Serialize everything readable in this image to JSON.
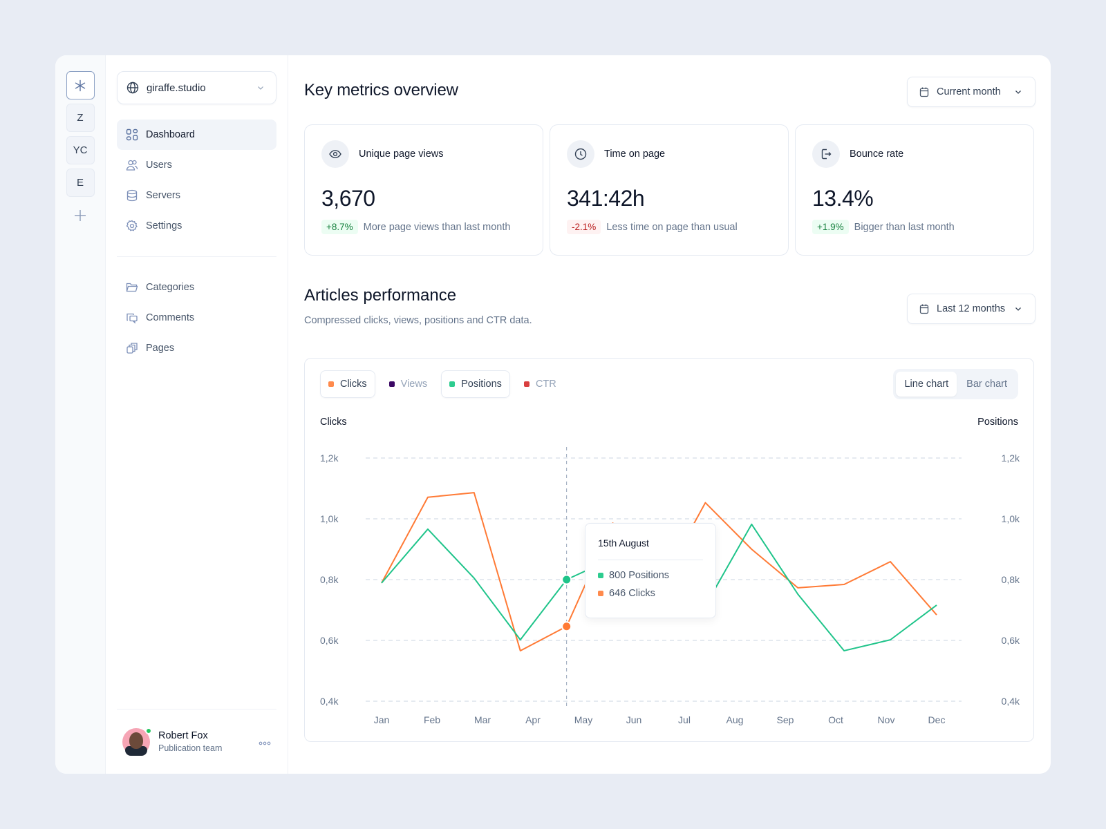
{
  "rail": {
    "items": [
      {
        "label": "",
        "icon": "asterisk-icon",
        "active": true
      },
      {
        "label": "Z"
      },
      {
        "label": "YC"
      },
      {
        "label": "E"
      }
    ],
    "add_icon": "plus-icon"
  },
  "sidebar": {
    "workspace": {
      "label": "giraffe.studio",
      "icon": "globe-icon"
    },
    "primary": [
      {
        "label": "Dashboard",
        "icon": "grid-icon",
        "active": true
      },
      {
        "label": "Users",
        "icon": "users-icon"
      },
      {
        "label": "Servers",
        "icon": "database-icon"
      },
      {
        "label": "Settings",
        "icon": "gear-icon"
      }
    ],
    "secondary": [
      {
        "label": "Categories",
        "icon": "folder-icon"
      },
      {
        "label": "Comments",
        "icon": "comments-icon"
      },
      {
        "label": "Pages",
        "icon": "pages-icon"
      }
    ],
    "user": {
      "name": "Robert Fox",
      "role": "Publication team",
      "status": "online"
    }
  },
  "header": {
    "title": "Key metrics overview",
    "period_select": "Current month"
  },
  "metrics": [
    {
      "title": "Unique page views",
      "icon": "eye-icon",
      "value": "3,670",
      "delta": "+8.7%",
      "trend": "up",
      "note": "More page views than last month"
    },
    {
      "title": "Time on page",
      "icon": "clock-icon",
      "value": "341:42h",
      "delta": "-2.1%",
      "trend": "down",
      "note": "Less time on page than usual"
    },
    {
      "title": "Bounce rate",
      "icon": "logout-icon",
      "value": "13.4%",
      "delta": "+1.9%",
      "trend": "up",
      "note": "Bigger than last month"
    }
  ],
  "performance": {
    "title": "Articles performance",
    "subtitle": "Compressed clicks, views, positions and CTR data.",
    "period_select": "Last 12 months",
    "legend": [
      {
        "label": "Clicks",
        "color": "#FF8A4C",
        "active": true
      },
      {
        "label": "Views",
        "color": "#3B0764",
        "active": false
      },
      {
        "label": "Positions",
        "color": "#2DCC8F",
        "active": true
      },
      {
        "label": "CTR",
        "color": "#D93F3F",
        "active": false
      }
    ],
    "chart_types": [
      {
        "label": "Line chart",
        "active": true
      },
      {
        "label": "Bar chart",
        "active": false
      }
    ],
    "tooltip": {
      "title": "15th August",
      "rows": [
        {
          "label": "800 Positions",
          "color": "#2DCC8F"
        },
        {
          "label": "646 Clicks",
          "color": "#FF8A4C"
        }
      ]
    }
  },
  "chart_data": {
    "type": "line",
    "title": "Articles performance",
    "ylabel_left": "Clicks",
    "ylabel_right": "Positions",
    "categories": [
      "Jan",
      "Feb",
      "Mar",
      "Apr",
      "May",
      "Jun",
      "Jul",
      "Aug",
      "Sep",
      "Oct",
      "Nov",
      "Dec"
    ],
    "y_ticks": [
      "1,2k",
      "1,0k",
      "0,8k",
      "0,6k",
      "0,4k"
    ],
    "ylim": [
      400,
      1200
    ],
    "grid": true,
    "points_per_series": 13,
    "series": [
      {
        "name": "Clicks",
        "color": "#FF7A35",
        "values": [
          789,
          1071,
          1086,
          566,
          646,
          986,
          775,
          1053,
          900,
          773,
          784,
          859,
          684
        ]
      },
      {
        "name": "Positions",
        "color": "#1FC48A",
        "values": [
          789,
          966,
          805,
          602,
          800,
          870,
          760,
          714,
          982,
          752,
          566,
          602,
          716
        ]
      }
    ],
    "highlight_index": 4,
    "highlight_label": "15th August"
  }
}
